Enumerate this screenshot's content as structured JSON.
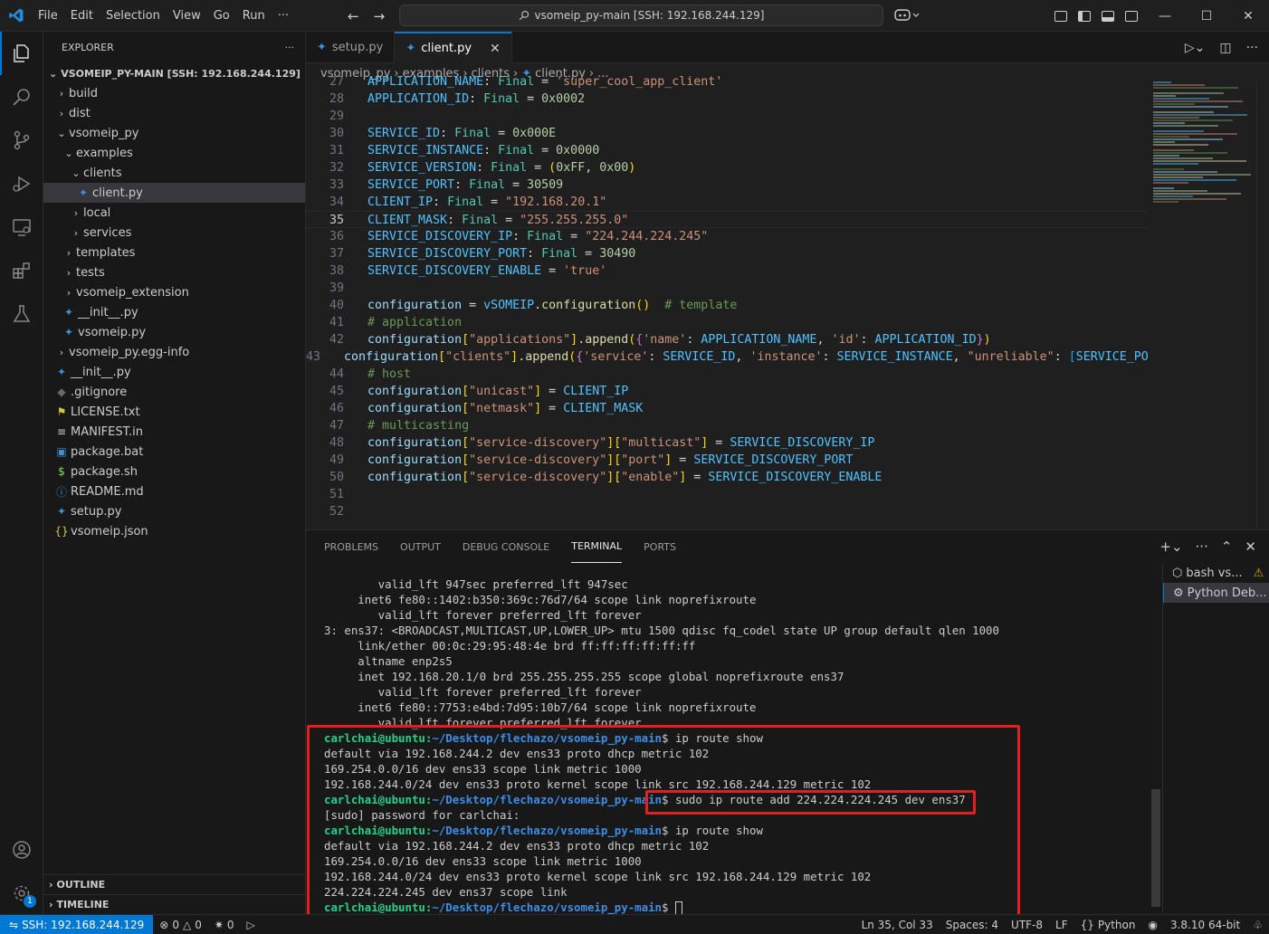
{
  "titlebar": {
    "menu": [
      "File",
      "Edit",
      "Selection",
      "View",
      "Go",
      "Run",
      "···"
    ],
    "command_center": "vsomeip_py-main [SSH: 192.168.244.129]"
  },
  "explorer": {
    "title": "EXPLORER",
    "more": "···",
    "root": "VSOMEIP_PY-MAIN [SSH: 192.168.244.129]",
    "tree": [
      {
        "label": "build",
        "depth": 1,
        "kind": "folder",
        "open": false
      },
      {
        "label": "dist",
        "depth": 1,
        "kind": "folder",
        "open": false
      },
      {
        "label": "vsomeip_py",
        "depth": 1,
        "kind": "folder",
        "open": true
      },
      {
        "label": "examples",
        "depth": 2,
        "kind": "folder",
        "open": true
      },
      {
        "label": "clients",
        "depth": 3,
        "kind": "folder",
        "open": true
      },
      {
        "label": "client.py",
        "depth": 4,
        "kind": "py",
        "selected": true
      },
      {
        "label": "local",
        "depth": 3,
        "kind": "folder",
        "open": false
      },
      {
        "label": "services",
        "depth": 3,
        "kind": "folder",
        "open": false
      },
      {
        "label": "templates",
        "depth": 2,
        "kind": "folder",
        "open": false
      },
      {
        "label": "tests",
        "depth": 2,
        "kind": "folder",
        "open": false
      },
      {
        "label": "vsomeip_extension",
        "depth": 2,
        "kind": "folder",
        "open": false
      },
      {
        "label": "__init__.py",
        "depth": 2,
        "kind": "py"
      },
      {
        "label": "vsomeip.py",
        "depth": 2,
        "kind": "py"
      },
      {
        "label": "vsomeip_py.egg-info",
        "depth": 1,
        "kind": "folder",
        "open": false
      },
      {
        "label": "__init__.py",
        "depth": 1,
        "kind": "py"
      },
      {
        "label": ".gitignore",
        "depth": 1,
        "kind": "git"
      },
      {
        "label": "LICENSE.txt",
        "depth": 1,
        "kind": "lic"
      },
      {
        "label": "MANIFEST.in",
        "depth": 1,
        "kind": "man"
      },
      {
        "label": "package.bat",
        "depth": 1,
        "kind": "bat"
      },
      {
        "label": "package.sh",
        "depth": 1,
        "kind": "sh"
      },
      {
        "label": "README.md",
        "depth": 1,
        "kind": "info"
      },
      {
        "label": "setup.py",
        "depth": 1,
        "kind": "py"
      },
      {
        "label": "vsomeip.json",
        "depth": 1,
        "kind": "json"
      }
    ],
    "outline": "OUTLINE",
    "timeline": "TIMELINE"
  },
  "tabs": [
    {
      "label": "setup.py",
      "active": false
    },
    {
      "label": "client.py",
      "active": true
    }
  ],
  "breadcrumb": [
    "vsomeip_py",
    "examples",
    "clients",
    "client.py",
    "..."
  ],
  "editor": {
    "current_line": 35,
    "lines": [
      {
        "n": 27,
        "t": [
          [
            "v",
            "APPLICATION_NAME"
          ],
          [
            "o",
            ": "
          ],
          [
            "t",
            "Final"
          ],
          [
            "o",
            " = "
          ],
          [
            "s",
            "'super_cool_app_client'"
          ]
        ]
      },
      {
        "n": 28,
        "t": [
          [
            "v",
            "APPLICATION_ID"
          ],
          [
            "o",
            ": "
          ],
          [
            "t",
            "Final"
          ],
          [
            "o",
            " = "
          ],
          [
            "n",
            "0x0002"
          ]
        ]
      },
      {
        "n": 29,
        "t": []
      },
      {
        "n": 30,
        "t": [
          [
            "v",
            "SERVICE_ID"
          ],
          [
            "o",
            ": "
          ],
          [
            "t",
            "Final"
          ],
          [
            "o",
            " = "
          ],
          [
            "n",
            "0x000E"
          ]
        ]
      },
      {
        "n": 31,
        "t": [
          [
            "v",
            "SERVICE_INSTANCE"
          ],
          [
            "o",
            ": "
          ],
          [
            "t",
            "Final"
          ],
          [
            "o",
            " = "
          ],
          [
            "n",
            "0x0000"
          ]
        ]
      },
      {
        "n": 32,
        "t": [
          [
            "v",
            "SERVICE_VERSION"
          ],
          [
            "o",
            ": "
          ],
          [
            "t",
            "Final"
          ],
          [
            "o",
            " = "
          ],
          [
            "b1",
            "("
          ],
          [
            "n",
            "0xFF"
          ],
          [
            "o",
            ", "
          ],
          [
            "n",
            "0x00"
          ],
          [
            "b1",
            ")"
          ]
        ]
      },
      {
        "n": 33,
        "t": [
          [
            "v",
            "SERVICE_PORT"
          ],
          [
            "o",
            ": "
          ],
          [
            "t",
            "Final"
          ],
          [
            "o",
            " = "
          ],
          [
            "n",
            "30509"
          ]
        ]
      },
      {
        "n": 34,
        "t": [
          [
            "v",
            "CLIENT_IP"
          ],
          [
            "o",
            ": "
          ],
          [
            "t",
            "Final"
          ],
          [
            "o",
            " = "
          ],
          [
            "s",
            "\"192.168.20.1\""
          ]
        ]
      },
      {
        "n": 35,
        "t": [
          [
            "v",
            "CLIENT_MASK"
          ],
          [
            "o",
            ": "
          ],
          [
            "t",
            "Final"
          ],
          [
            "o",
            " = "
          ],
          [
            "s",
            "\"255.255.255.0\""
          ]
        ]
      },
      {
        "n": 36,
        "t": [
          [
            "v",
            "SERVICE_DISCOVERY_IP"
          ],
          [
            "o",
            ": "
          ],
          [
            "t",
            "Final"
          ],
          [
            "o",
            " = "
          ],
          [
            "s",
            "\"224.244.224.245\""
          ]
        ]
      },
      {
        "n": 37,
        "t": [
          [
            "v",
            "SERVICE_DISCOVERY_PORT"
          ],
          [
            "o",
            ": "
          ],
          [
            "t",
            "Final"
          ],
          [
            "o",
            " = "
          ],
          [
            "n",
            "30490"
          ]
        ]
      },
      {
        "n": 38,
        "t": [
          [
            "v",
            "SERVICE_DISCOVERY_ENABLE"
          ],
          [
            "o",
            " = "
          ],
          [
            "s",
            "'true'"
          ]
        ]
      },
      {
        "n": 39,
        "t": []
      },
      {
        "n": 40,
        "t": [
          [
            "var",
            "configuration"
          ],
          [
            "o",
            " = "
          ],
          [
            "v",
            "vSOMEIP"
          ],
          [
            "o",
            "."
          ],
          [
            "f",
            "configuration"
          ],
          [
            "b1",
            "()"
          ],
          [
            "o",
            "  "
          ],
          [
            "c",
            "# template"
          ]
        ]
      },
      {
        "n": 41,
        "t": [
          [
            "c",
            "# application"
          ]
        ]
      },
      {
        "n": 42,
        "t": [
          [
            "var",
            "configuration"
          ],
          [
            "b1",
            "["
          ],
          [
            "s",
            "\"applications\""
          ],
          [
            "b1",
            "]"
          ],
          [
            "o",
            "."
          ],
          [
            "f",
            "append"
          ],
          [
            "b1",
            "("
          ],
          [
            "b2",
            "{"
          ],
          [
            "s",
            "'name'"
          ],
          [
            "o",
            ": "
          ],
          [
            "v",
            "APPLICATION_NAME"
          ],
          [
            "o",
            ", "
          ],
          [
            "s",
            "'id'"
          ],
          [
            "o",
            ": "
          ],
          [
            "v",
            "APPLICATION_ID"
          ],
          [
            "b2",
            "}"
          ],
          [
            "b1",
            ")"
          ]
        ]
      },
      {
        "n": 43,
        "t": [
          [
            "var",
            "configuration"
          ],
          [
            "b1",
            "["
          ],
          [
            "s",
            "\"clients\""
          ],
          [
            "b1",
            "]"
          ],
          [
            "o",
            "."
          ],
          [
            "f",
            "append"
          ],
          [
            "b1",
            "("
          ],
          [
            "b2",
            "{"
          ],
          [
            "s",
            "'service'"
          ],
          [
            "o",
            ": "
          ],
          [
            "v",
            "SERVICE_ID"
          ],
          [
            "o",
            ", "
          ],
          [
            "s",
            "'instance'"
          ],
          [
            "o",
            ": "
          ],
          [
            "v",
            "SERVICE_INSTANCE"
          ],
          [
            "o",
            ", "
          ],
          [
            "s",
            "\"unreliable\""
          ],
          [
            "o",
            ": "
          ],
          [
            "b3",
            "["
          ],
          [
            "v",
            "SERVICE_POR"
          ]
        ]
      },
      {
        "n": 44,
        "t": [
          [
            "c",
            "# host"
          ]
        ]
      },
      {
        "n": 45,
        "t": [
          [
            "var",
            "configuration"
          ],
          [
            "b1",
            "["
          ],
          [
            "s",
            "\"unicast\""
          ],
          [
            "b1",
            "]"
          ],
          [
            "o",
            " = "
          ],
          [
            "v",
            "CLIENT_IP"
          ]
        ]
      },
      {
        "n": 46,
        "t": [
          [
            "var",
            "configuration"
          ],
          [
            "b1",
            "["
          ],
          [
            "s",
            "\"netmask\""
          ],
          [
            "b1",
            "]"
          ],
          [
            "o",
            " = "
          ],
          [
            "v",
            "CLIENT_MASK"
          ]
        ]
      },
      {
        "n": 47,
        "t": [
          [
            "c",
            "# multicasting"
          ]
        ]
      },
      {
        "n": 48,
        "t": [
          [
            "var",
            "configuration"
          ],
          [
            "b1",
            "["
          ],
          [
            "s",
            "\"service-discovery\""
          ],
          [
            "b1",
            "]["
          ],
          [
            "s",
            "\"multicast\""
          ],
          [
            "b1",
            "]"
          ],
          [
            "o",
            " = "
          ],
          [
            "v",
            "SERVICE_DISCOVERY_IP"
          ]
        ]
      },
      {
        "n": 49,
        "t": [
          [
            "var",
            "configuration"
          ],
          [
            "b1",
            "["
          ],
          [
            "s",
            "\"service-discovery\""
          ],
          [
            "b1",
            "]["
          ],
          [
            "s",
            "\"port\""
          ],
          [
            "b1",
            "]"
          ],
          [
            "o",
            " = "
          ],
          [
            "v",
            "SERVICE_DISCOVERY_PORT"
          ]
        ]
      },
      {
        "n": 50,
        "t": [
          [
            "var",
            "configuration"
          ],
          [
            "b1",
            "["
          ],
          [
            "s",
            "\"service-discovery\""
          ],
          [
            "b1",
            "]["
          ],
          [
            "s",
            "\"enable\""
          ],
          [
            "b1",
            "]"
          ],
          [
            "o",
            " = "
          ],
          [
            "v",
            "SERVICE_DISCOVERY_ENABLE"
          ]
        ]
      },
      {
        "n": 51,
        "t": []
      },
      {
        "n": 52,
        "t": []
      }
    ]
  },
  "panel": {
    "tabs": [
      "PROBLEMS",
      "OUTPUT",
      "DEBUG CONSOLE",
      "TERMINAL",
      "PORTS"
    ],
    "active_tab": "TERMINAL",
    "terminals": [
      {
        "label": "bash vs...",
        "warning": true,
        "active": false
      },
      {
        "label": "Python Deb...",
        "warning": false,
        "active": true
      }
    ],
    "prompt_user": "carlchai@ubuntu",
    "prompt_path": "~/Desktop/flechazo/vsomeip_py-main",
    "lines": [
      {
        "text": "        valid_lft 947sec preferred_lft 947sec"
      },
      {
        "text": "     inet6 fe80::1402:b350:369c:76d7/64 scope link noprefixroute"
      },
      {
        "text": "        valid_lft forever preferred_lft forever"
      },
      {
        "text": "3: ens37: <BROADCAST,MULTICAST,UP,LOWER_UP> mtu 1500 qdisc fq_codel state UP group default qlen 1000"
      },
      {
        "text": "     link/ether 00:0c:29:95:48:4e brd ff:ff:ff:ff:ff:ff"
      },
      {
        "text": "     altname enp2s5"
      },
      {
        "text": "     inet 192.168.20.1/0 brd 255.255.255.255 scope global noprefixroute ens37"
      },
      {
        "text": "        valid_lft forever preferred_lft forever"
      },
      {
        "text": "     inet6 fe80::7753:e4bd:7d95:10b7/64 scope link noprefixroute"
      },
      {
        "text": "        valid_lft forever preferred_lft forever"
      },
      {
        "prompt": true,
        "cmd": " ip route show"
      },
      {
        "text": "default via 192.168.244.2 dev ens33 proto dhcp metric 102"
      },
      {
        "text": "169.254.0.0/16 dev ens33 scope link metric 1000"
      },
      {
        "text": "192.168.244.0/24 dev ens33 proto kernel scope link src 192.168.244.129 metric 102"
      },
      {
        "prompt": true,
        "cmd": " sudo ip route add 224.224.224.245 dev ens37"
      },
      {
        "text": "[sudo] password for carlchai:"
      },
      {
        "prompt": true,
        "cmd": " ip route show"
      },
      {
        "text": "default via 192.168.244.2 dev ens33 proto dhcp metric 102"
      },
      {
        "text": "169.254.0.0/16 dev ens33 scope link metric 1000"
      },
      {
        "text": "192.168.244.0/24 dev ens33 proto kernel scope link src 192.168.244.129 metric 102"
      },
      {
        "text": "224.224.224.245 dev ens37 scope link"
      },
      {
        "prompt": true,
        "cmd": " ",
        "cursor": true
      }
    ]
  },
  "statusbar": {
    "remote": "SSH: 192.168.244.129",
    "errors": "0",
    "warnings": "0",
    "ports": "0",
    "position": "Ln 35, Col 33",
    "spaces": "Spaces: 4",
    "encoding": "UTF-8",
    "eol": "LF",
    "language": "Python",
    "interpreter": "3.8.10 64-bit"
  }
}
